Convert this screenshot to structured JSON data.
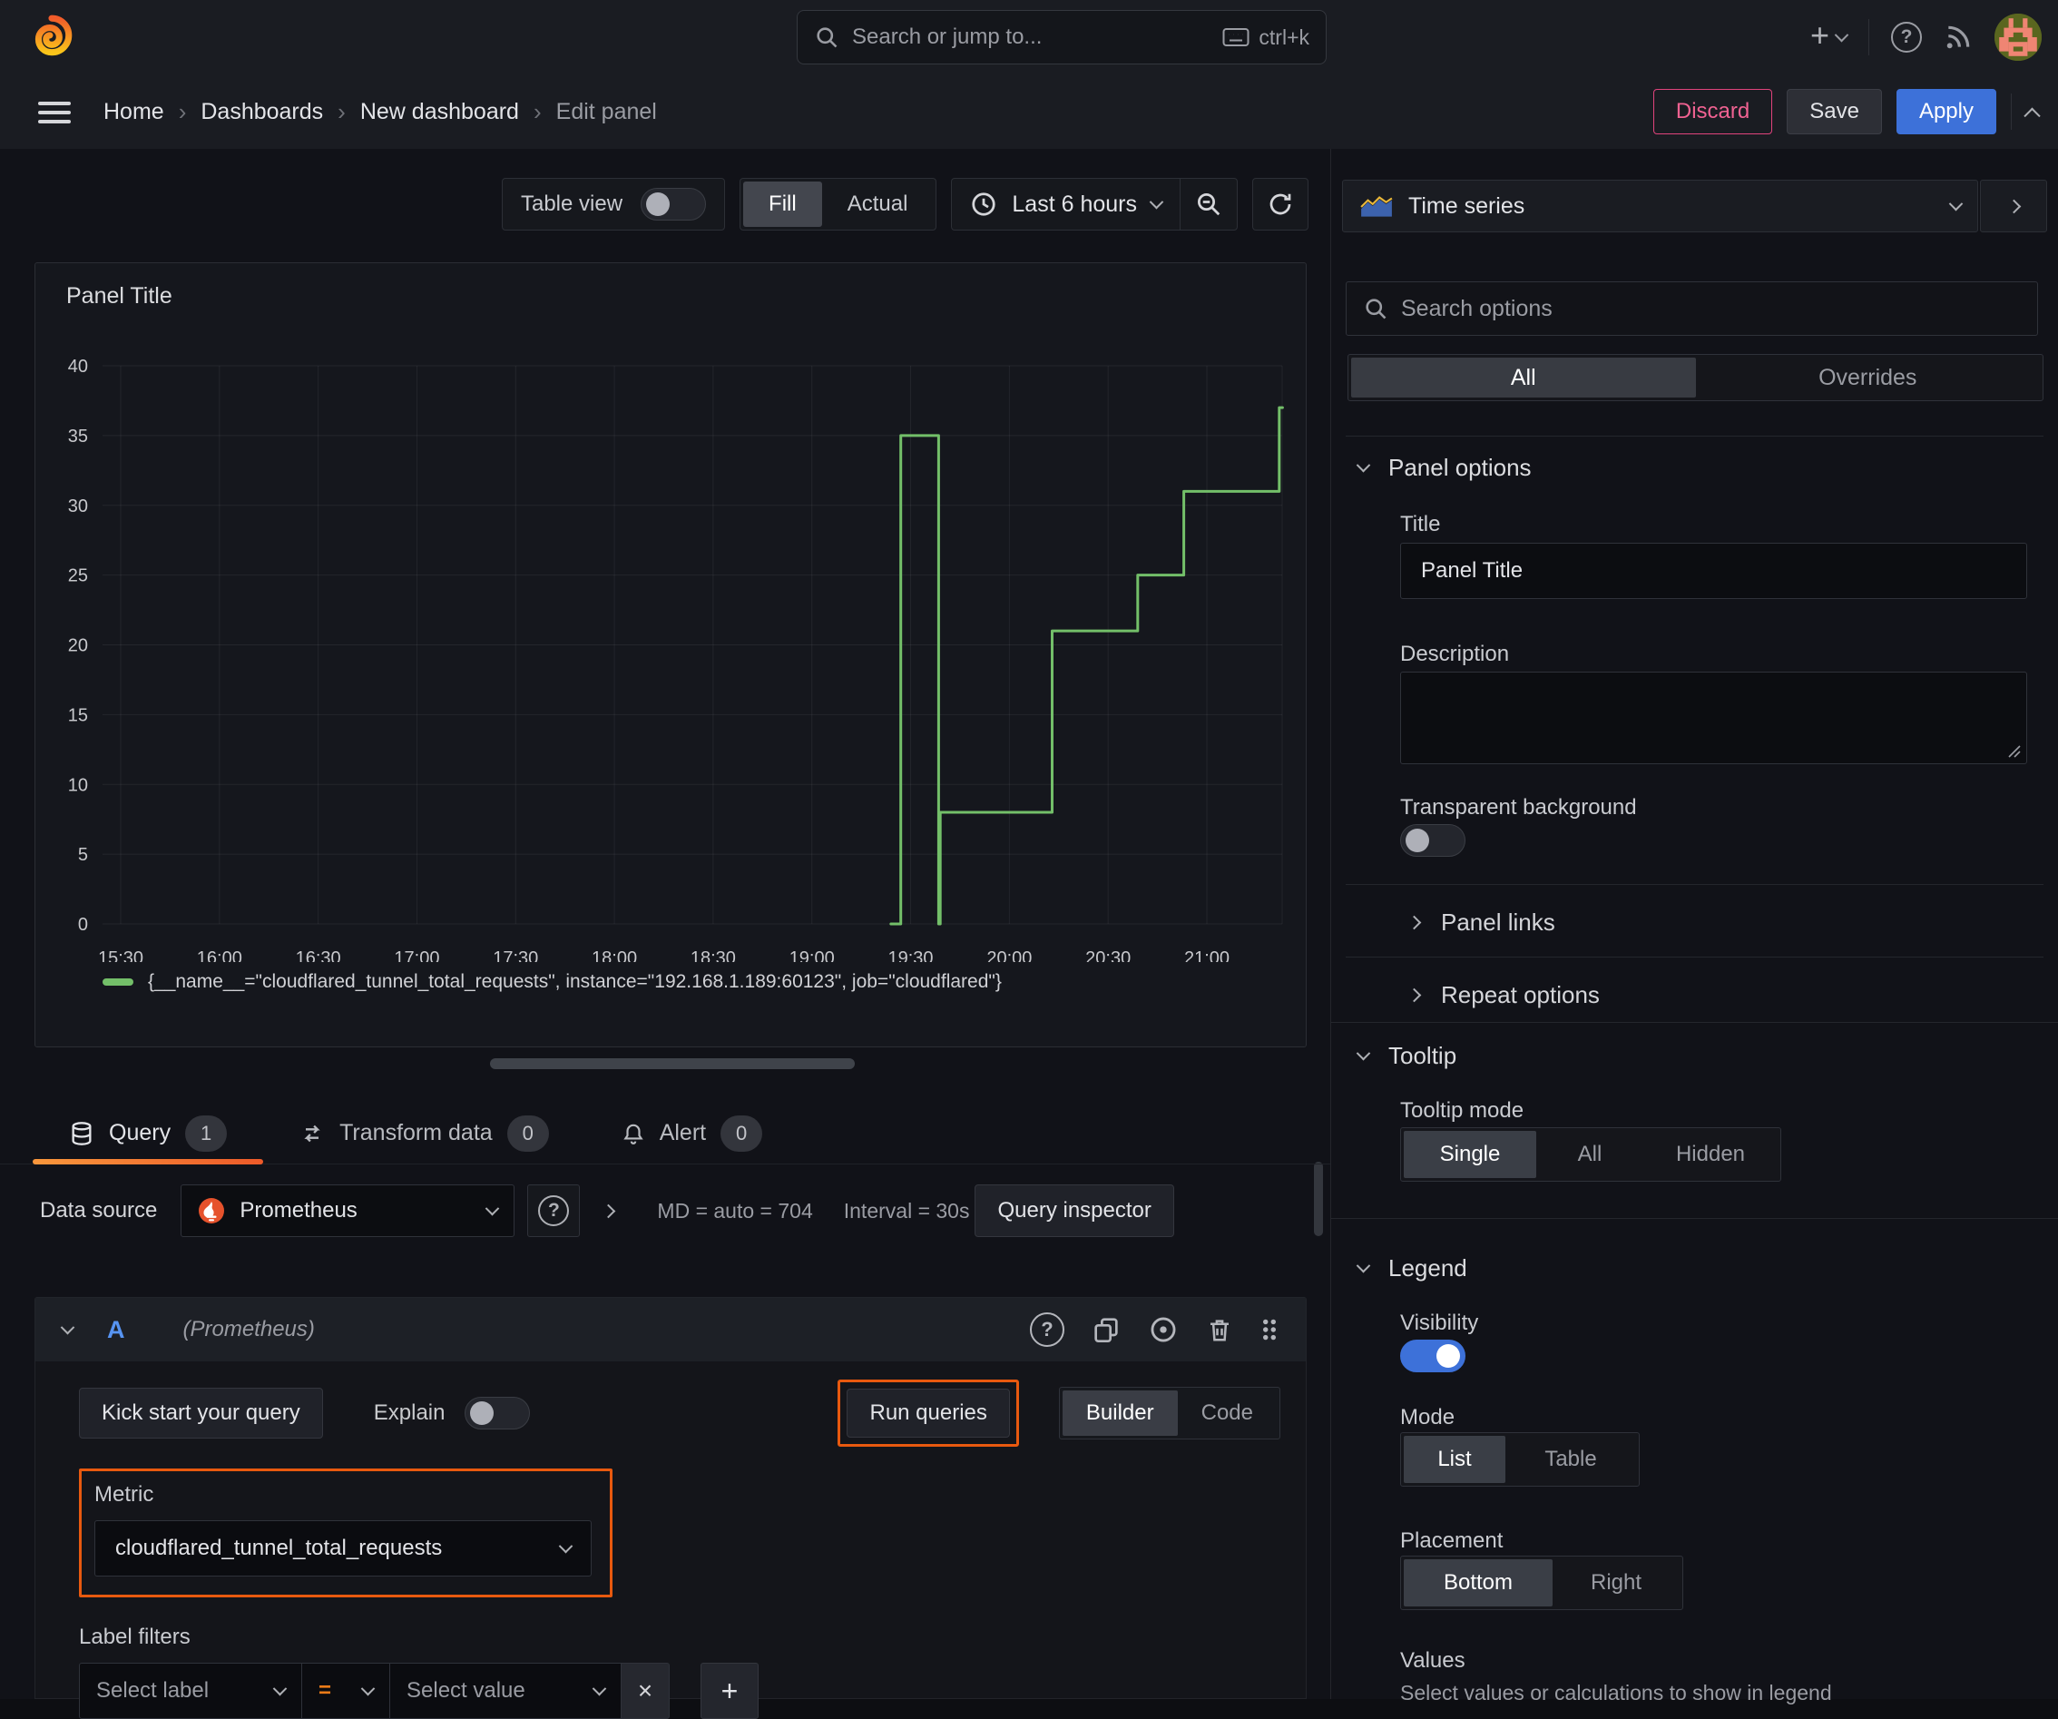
{
  "topbar": {
    "search_placeholder": "Search or jump to...",
    "shortcut": "ctrl+k"
  },
  "breadcrumb": {
    "home": "Home",
    "dashboards": "Dashboards",
    "new_dashboard": "New dashboard",
    "edit_panel": "Edit panel"
  },
  "actions": {
    "discard": "Discard",
    "save": "Save",
    "apply": "Apply"
  },
  "toolbar": {
    "table_view": "Table view",
    "fill": "Fill",
    "actual": "Actual",
    "time_range": "Last 6 hours"
  },
  "panel": {
    "title": "Panel Title"
  },
  "chart_data": {
    "type": "line",
    "title": "Panel Title",
    "line_style": "step",
    "grid": true,
    "legend_position": "bottom",
    "x_axis": {
      "unit": "time",
      "start_label": "15:30",
      "tick_labels": [
        "15:30",
        "16:00",
        "16:30",
        "17:00",
        "17:30",
        "18:00",
        "18:30",
        "19:00",
        "19:30",
        "20:00",
        "20:30",
        "21:00"
      ],
      "tick_minutes_from_start": [
        0,
        30,
        60,
        90,
        120,
        150,
        180,
        210,
        240,
        270,
        300,
        330
      ]
    },
    "y_axis": {
      "min": 0,
      "max": 40,
      "ticks": [
        0,
        5,
        10,
        15,
        20,
        25,
        30,
        35,
        40
      ]
    },
    "series": [
      {
        "name": "{__name__=\"cloudflared_tunnel_total_requests\", instance=\"192.168.1.189:60123\", job=\"cloudflared\"}",
        "color": "#73bf69",
        "point_format": "[minutes_after_15:30, requests]",
        "points": [
          [
            234,
            0
          ],
          [
            237,
            0
          ],
          [
            237,
            35
          ],
          [
            248.5,
            35
          ],
          [
            248.5,
            0
          ],
          [
            249,
            0
          ],
          [
            249,
            8
          ],
          [
            283,
            8
          ],
          [
            283,
            21
          ],
          [
            309,
            21
          ],
          [
            309,
            25
          ],
          [
            323,
            25
          ],
          [
            323,
            31
          ],
          [
            352,
            31
          ],
          [
            352,
            37
          ],
          [
            353,
            37
          ]
        ]
      }
    ]
  },
  "tabs": {
    "query": "Query",
    "query_count": "1",
    "transform": "Transform data",
    "transform_count": "0",
    "alert": "Alert",
    "alert_count": "0"
  },
  "datasource": {
    "label": "Data source",
    "name": "Prometheus",
    "help": "?",
    "md_stat": "MD = auto = 704",
    "interval_stat": "Interval = 30s",
    "query_inspector": "Query inspector"
  },
  "query_editor": {
    "ref_id": "A",
    "ds_hint": "(Prometheus)",
    "kick_start": "Kick start your query",
    "explain": "Explain",
    "run_queries": "Run queries",
    "builder": "Builder",
    "code": "Code",
    "metric_label": "Metric",
    "metric_value": "cloudflared_tunnel_total_requests",
    "label_filters": "Label filters",
    "select_label": "Select label",
    "operator": "=",
    "select_value": "Select value",
    "remove": "×",
    "add": "+"
  },
  "sidebar": {
    "viz_name": "Time series",
    "search_placeholder": "Search options",
    "tab_all": "All",
    "tab_overrides": "Overrides",
    "panel_options": {
      "heading": "Panel options",
      "title_label": "Title",
      "title_value": "Panel Title",
      "description_label": "Description",
      "transparent_label": "Transparent background"
    },
    "panel_links": "Panel links",
    "repeat_options": "Repeat options",
    "tooltip": {
      "heading": "Tooltip",
      "mode_label": "Tooltip mode",
      "single": "Single",
      "all": "All",
      "hidden": "Hidden"
    },
    "legend": {
      "heading": "Legend",
      "visibility_label": "Visibility",
      "mode_label": "Mode",
      "list": "List",
      "table": "Table",
      "placement_label": "Placement",
      "bottom": "Bottom",
      "right": "Right",
      "values_label": "Values",
      "values_hint": "Select values or calculations to show in legend"
    }
  },
  "colors": {
    "accent_blue": "#3d71d9",
    "destructive_pink": "#e0437c",
    "highlight_orange": "#e8590f",
    "series_green": "#73bf69",
    "prometheus_orange": "#e6522c",
    "tab_underline": "#ed5a29"
  }
}
